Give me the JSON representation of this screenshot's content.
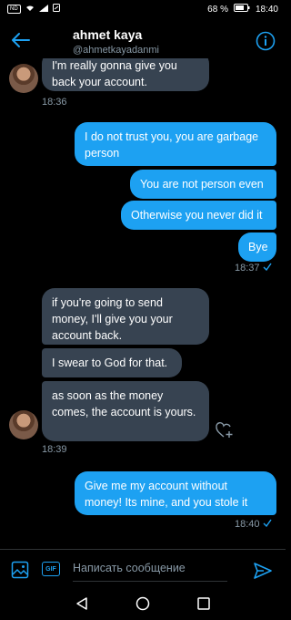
{
  "status_bar": {
    "left_badge": "ND",
    "battery_pct": "68 %",
    "time": "18:40"
  },
  "header": {
    "name": "ahmet kaya",
    "handle": "@ahmetkayadanmi"
  },
  "messages": [
    {
      "id": "m1",
      "dir": "in",
      "text": "I'm really gonna give you back your account."
    },
    {
      "id": "m2",
      "dir": "out",
      "text": "I do not trust you, you are garbage person"
    },
    {
      "id": "m3",
      "dir": "out",
      "text": "You are not person even"
    },
    {
      "id": "m4",
      "dir": "out",
      "text": "Otherwise you never did it"
    },
    {
      "id": "m5",
      "dir": "out",
      "text": "Bye"
    },
    {
      "id": "m6",
      "dir": "in",
      "text": "if you're going to send money, I'll give you your account back."
    },
    {
      "id": "m7",
      "dir": "in",
      "text": "I swear to God for that."
    },
    {
      "id": "m8",
      "dir": "in",
      "text": "as soon as the money comes, the account is yours."
    },
    {
      "id": "m9",
      "dir": "out",
      "text": "Give me my account without money! Its mine, and you stole it"
    }
  ],
  "timestamps": {
    "t1": "18:36",
    "t2": "18:37",
    "t3": "18:39",
    "t4": "18:40"
  },
  "composer": {
    "placeholder": "Написать сообщение",
    "gif_label": "GIF"
  },
  "colors": {
    "accent": "#1da1f2",
    "incoming_bubble": "#374351",
    "background": "#000000",
    "muted_text": "#8899a6"
  },
  "icons": [
    "back-arrow-icon",
    "info-icon",
    "image-icon",
    "gif-icon",
    "send-icon",
    "heart-plus-icon",
    "checkmark-icon",
    "nav-back-icon",
    "nav-home-icon",
    "nav-recent-icon"
  ]
}
